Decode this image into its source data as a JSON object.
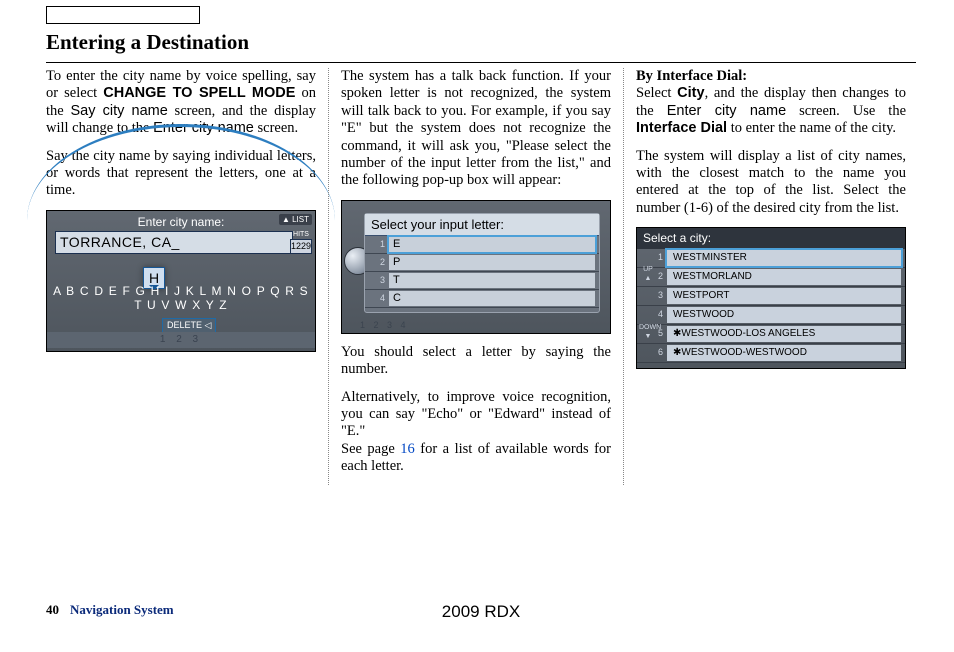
{
  "page": {
    "title": "Entering a Destination",
    "page_number": "40",
    "section": "Navigation System",
    "model": "2009  RDX"
  },
  "col1": {
    "p1a": "To enter the city name by voice spelling, say or select ",
    "p1b": "CHANGE TO SPELL MODE",
    "p1c": " on the ",
    "p1d": "Say city name",
    "p1e": " screen, and the display will change to the ",
    "p1f": "Enter city name",
    "p1g": " screen.",
    "p2": "Say the city name by saying individual letters, or words that represent the letters, one at a time."
  },
  "ss1": {
    "header": "Enter city name:",
    "list_label": "▲ LIST",
    "input": "TORRANCE, CA_",
    "hits_label": "HITS",
    "hits_value": "1229",
    "letters": "A B C D E F G H I J K L M N O P Q R S T U V W X Y Z",
    "highlight": "H",
    "delete": "DELETE ◁",
    "numbers": "1 2 3"
  },
  "col2": {
    "p1": "The system has a talk back function. If your spoken letter is not recognized, the system will talk back to you. For example, if you say \"E\" but the system does not recognize the command, it will ask you, \"Please select the number of the input letter from the list,\" and the following pop-up box will appear:",
    "p2": "You should select a letter by saying the number.",
    "p3a": "Alternatively, to improve voice recognition, you can say \"Echo\" or \"Edward\" instead of \"E.\"",
    "p3b": "See page ",
    "p3c": "16",
    "p3d": " for a list of available words for each letter."
  },
  "ss2": {
    "header": "Select your input letter:",
    "rows": [
      {
        "n": "1",
        "v": "E"
      },
      {
        "n": "2",
        "v": "P"
      },
      {
        "n": "3",
        "v": "T"
      },
      {
        "n": "4",
        "v": "C"
      }
    ],
    "bottom": "1 2 3 4"
  },
  "col3": {
    "h": "By Interface Dial:",
    "p1a": "Select ",
    "p1b": "City",
    "p1c": ", and the display then changes to the ",
    "p1d": "Enter city name",
    "p1e": " screen. Use the ",
    "p1f": "Interface Dial",
    "p1g": " to enter the name of the city.",
    "p2": "The system will display a list of city names, with the closest match to the name you entered at the top of the list. Select the number (1-6) of the desired city from the list."
  },
  "ss3": {
    "header": "Select a city:",
    "up": "UP ▲",
    "down": "DOWN ▼",
    "rows": [
      {
        "n": "1",
        "v": "WESTMINSTER"
      },
      {
        "n": "2",
        "v": "WESTMORLAND"
      },
      {
        "n": "3",
        "v": "WESTPORT"
      },
      {
        "n": "4",
        "v": "WESTWOOD"
      },
      {
        "n": "5",
        "v": "✱WESTWOOD-LOS ANGELES"
      },
      {
        "n": "6",
        "v": "✱WESTWOOD-WESTWOOD"
      }
    ]
  }
}
